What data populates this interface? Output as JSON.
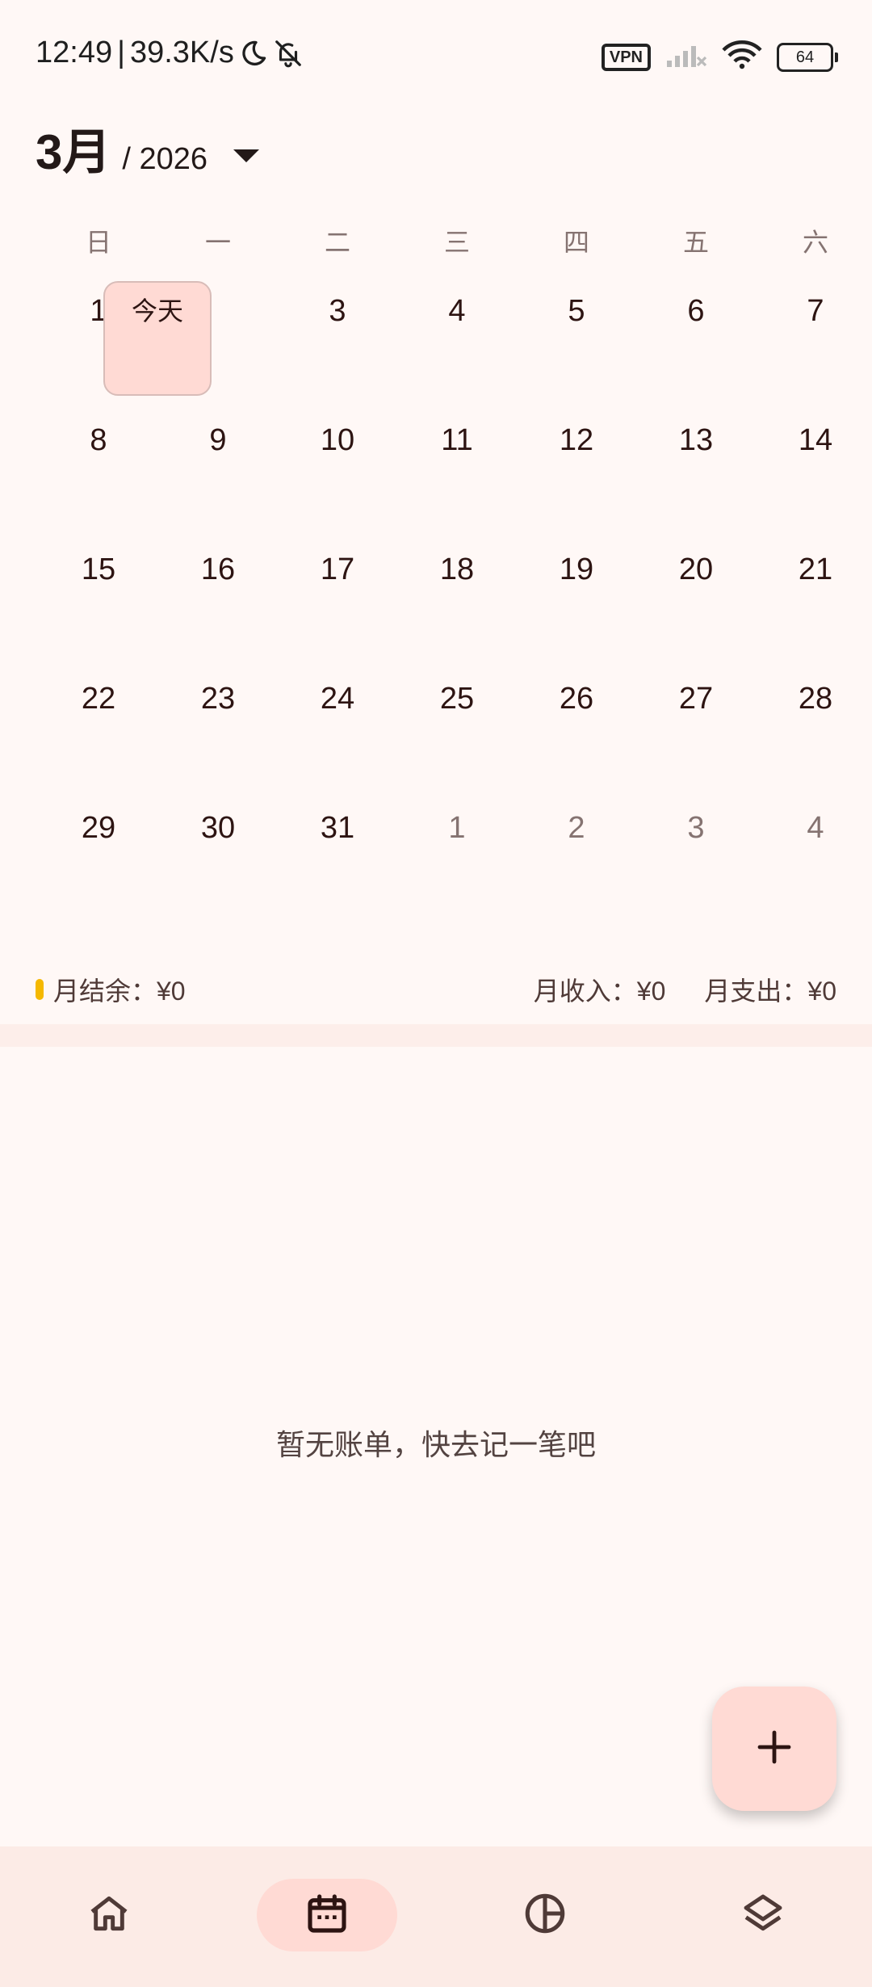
{
  "status_bar": {
    "time": "12:49",
    "separator": "|",
    "network_speed": "39.3K/s",
    "vpn": "VPN",
    "battery": "64",
    "icons": [
      "moon-icon",
      "bell-off-icon",
      "signal-icon",
      "wifi-icon",
      "battery-icon"
    ]
  },
  "header": {
    "month": "3月",
    "year": "/ 2026"
  },
  "calendar": {
    "weekdays": [
      "日",
      "一",
      "二",
      "三",
      "四",
      "五",
      "六"
    ],
    "today_label": "今天",
    "weeks": [
      [
        {
          "d": "1"
        },
        {
          "d": "",
          "today": true
        },
        {
          "d": "3"
        },
        {
          "d": "4"
        },
        {
          "d": "5"
        },
        {
          "d": "6"
        },
        {
          "d": "7"
        }
      ],
      [
        {
          "d": "8"
        },
        {
          "d": "9"
        },
        {
          "d": "10"
        },
        {
          "d": "11"
        },
        {
          "d": "12"
        },
        {
          "d": "13"
        },
        {
          "d": "14"
        }
      ],
      [
        {
          "d": "15"
        },
        {
          "d": "16"
        },
        {
          "d": "17"
        },
        {
          "d": "18"
        },
        {
          "d": "19"
        },
        {
          "d": "20"
        },
        {
          "d": "21"
        }
      ],
      [
        {
          "d": "22"
        },
        {
          "d": "23"
        },
        {
          "d": "24"
        },
        {
          "d": "25"
        },
        {
          "d": "26"
        },
        {
          "d": "27"
        },
        {
          "d": "28"
        }
      ],
      [
        {
          "d": "29"
        },
        {
          "d": "30"
        },
        {
          "d": "31"
        },
        {
          "d": "1",
          "muted": true
        },
        {
          "d": "2",
          "muted": true
        },
        {
          "d": "3",
          "muted": true
        },
        {
          "d": "4",
          "muted": true
        }
      ]
    ]
  },
  "summary": {
    "balance": "月结余：¥0",
    "income": "月收入：¥0",
    "expense": "月支出：¥0"
  },
  "empty_state": "暂无账单，快去记一笔吧",
  "fab": {
    "icon": "plus-icon"
  },
  "nav": {
    "items": [
      {
        "icon": "home-icon"
      },
      {
        "icon": "calendar-icon",
        "active": true
      },
      {
        "icon": "pie-chart-icon"
      },
      {
        "icon": "layers-icon"
      }
    ]
  },
  "colors": {
    "background": "#fff8f6",
    "accent_container": "#ffdad4",
    "nav_background": "#fcebe6",
    "balance_dot": "#f5b800"
  }
}
